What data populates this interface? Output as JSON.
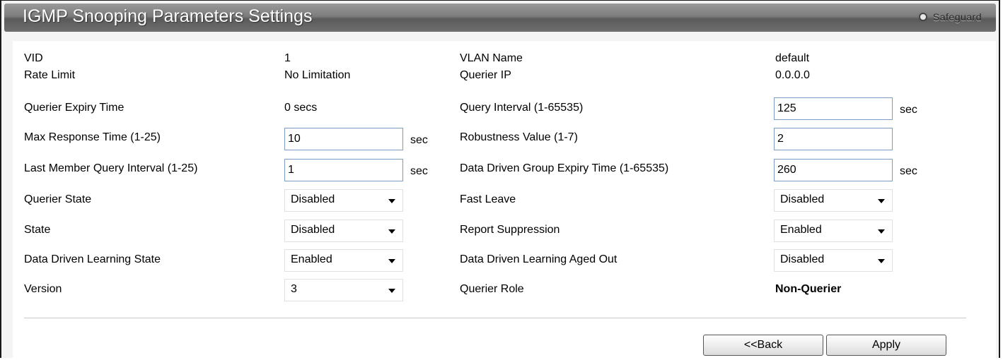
{
  "window": {
    "title": "IGMP Snooping Parameters Settings",
    "safeguard_label": "Safeguard"
  },
  "fields": {
    "vid": {
      "label": "VID",
      "value": "1"
    },
    "rate_limit": {
      "label": "Rate Limit",
      "value": "No Limitation"
    },
    "querier_expiry_time": {
      "label": "Querier Expiry Time",
      "value": "0 secs"
    },
    "max_response_time": {
      "label": "Max Response Time (1-25)",
      "value": "10",
      "unit": "sec"
    },
    "last_member_query_interval": {
      "label": "Last Member Query Interval (1-25)",
      "value": "1",
      "unit": "sec"
    },
    "querier_state": {
      "label": "Querier State",
      "value": "Disabled"
    },
    "state": {
      "label": "State",
      "value": "Disabled"
    },
    "data_driven_learning_state": {
      "label": "Data Driven Learning State",
      "value": "Enabled"
    },
    "version": {
      "label": "Version",
      "value": "3"
    },
    "vlan_name": {
      "label": "VLAN Name",
      "value": "default"
    },
    "querier_ip": {
      "label": "Querier IP",
      "value": "0.0.0.0"
    },
    "query_interval": {
      "label": "Query Interval (1-65535)",
      "value": "125",
      "unit": "sec"
    },
    "robustness_value": {
      "label": "Robustness Value (1-7)",
      "value": "2"
    },
    "data_driven_group_expiry_time": {
      "label": "Data Driven Group Expiry Time (1-65535)",
      "value": "260",
      "unit": "sec"
    },
    "fast_leave": {
      "label": "Fast Leave",
      "value": "Disabled"
    },
    "report_suppression": {
      "label": "Report Suppression",
      "value": "Enabled"
    },
    "data_driven_learning_aged_out": {
      "label": "Data Driven Learning Aged Out",
      "value": "Disabled"
    },
    "querier_role": {
      "label": "Querier Role",
      "value": "Non-Querier"
    }
  },
  "buttons": {
    "back": "<<Back",
    "apply": "Apply"
  }
}
